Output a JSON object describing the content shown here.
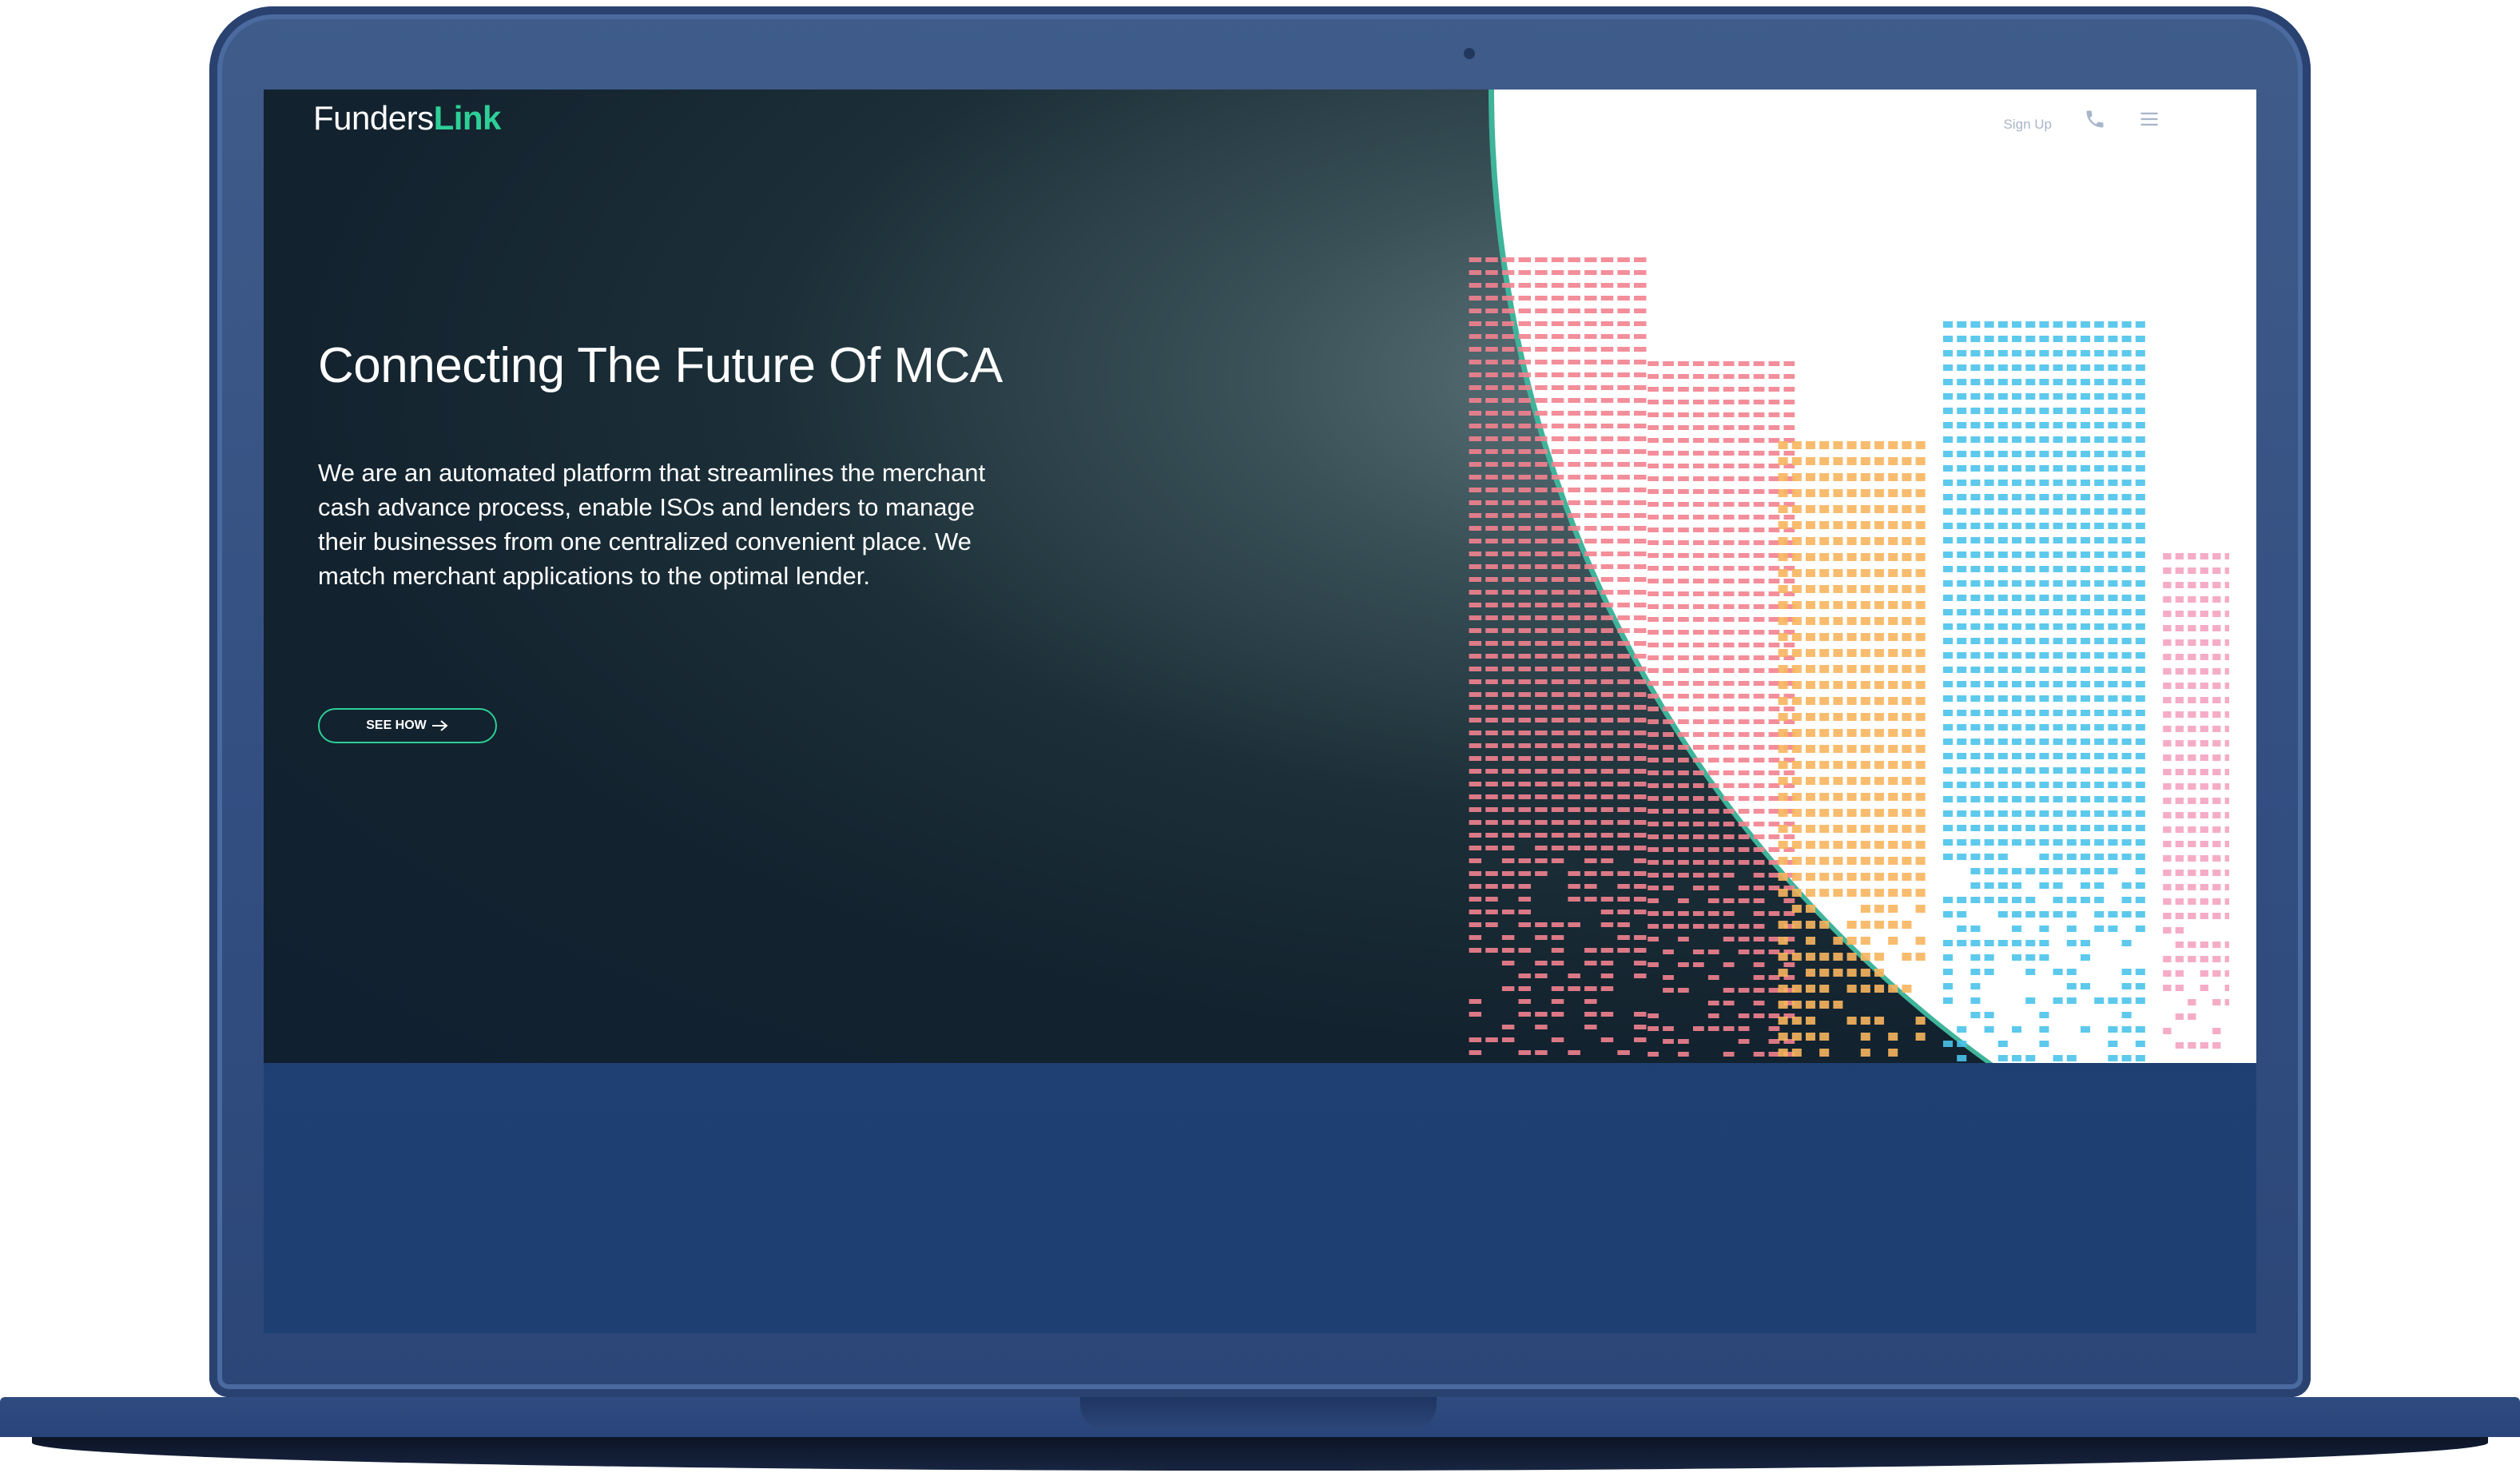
{
  "brand": {
    "name_part1": "Funders",
    "name_part2": "Link",
    "accent_color": "#2ecf96"
  },
  "nav": {
    "signup_label": "Sign Up",
    "phone_icon": "phone-icon",
    "menu_icon": "hamburger-menu-icon"
  },
  "hero": {
    "headline": "Connecting The Future Of MCA",
    "intro": "We are an automated platform that streamlines the merchant cash advance process, enable ISOs and lenders to manage their businesses from one centralized convenient place. We match merchant applications to the optimal lender.",
    "cta_label": "SEE HOW",
    "cta_icon": "arrow-right-icon"
  },
  "illustration": {
    "name": "city-skyline-illustration",
    "colors": {
      "pink": "#f2828f",
      "orange": "#f7b55e",
      "blue": "#4bc3ea",
      "rose": "#f4a3c0"
    }
  }
}
